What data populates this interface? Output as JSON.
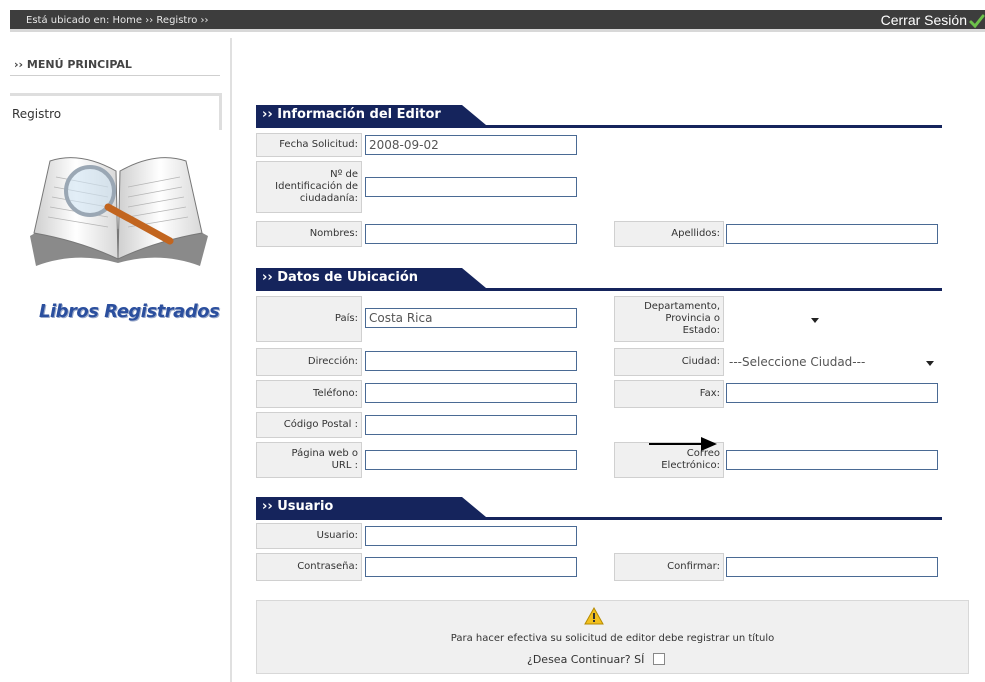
{
  "topbar": {
    "breadcrumb": "Está ubicado en: Home ›› Registro ››",
    "logout_label": "Cerrar Sesión"
  },
  "sidebar": {
    "menu_title": "›› MENÚ PRINCIPAL",
    "items": [
      {
        "label": "Registro"
      }
    ],
    "brand_text": "Libros Registrados"
  },
  "sections": {
    "editor": "›› Información del Editor",
    "ubicacion": "›› Datos de Ubicación",
    "usuario": "›› Usuario"
  },
  "editor": {
    "fecha_label": "Fecha Solicitud:",
    "fecha_value": "2008-09-02",
    "id_label_1": "Nº de",
    "id_label_2": "Identificación de",
    "id_label_3": "ciudadanía:",
    "id_value": "",
    "nombres_label": "Nombres:",
    "nombres_value": "",
    "apellidos_label": "Apellidos:",
    "apellidos_value": ""
  },
  "ubicacion": {
    "pais_label": "País:",
    "pais_value": "Costa Rica",
    "depto_label_1": "Departamento,",
    "depto_label_2": "Provincia o",
    "depto_label_3": "Estado:",
    "depto_value": "",
    "direccion_label": "Dirección:",
    "direccion_value": "",
    "ciudad_label": "Ciudad:",
    "ciudad_value": "---Seleccione Ciudad---",
    "telefono_label": "Teléfono:",
    "telefono_value": "",
    "fax_label": "Fax:",
    "fax_value": "",
    "postal_label": "Código Postal :",
    "postal_value": "",
    "web_label_1": "Página web o",
    "web_label_2": "URL :",
    "web_value": "",
    "correo_label_1": "Correo",
    "correo_label_2": "Electrónico:",
    "correo_value": ""
  },
  "usuario": {
    "usuario_label": "Usuario:",
    "usuario_value": "",
    "pass_label": "Contraseña:",
    "pass_value": "",
    "confirm_label": "Confirmar:",
    "confirm_value": ""
  },
  "notice": {
    "message": "Para hacer efectiva su solicitud de editor debe registrar un título",
    "question": "¿Desea Continuar? SÍ",
    "checked": false
  },
  "colors": {
    "section_bar": "#15245c",
    "topbar": "#3d3d3d",
    "input_border": "#4a6a94",
    "brand": "#2b4f9e",
    "check_icon": "#6cc24a",
    "warning_icon": "#f2c01e"
  },
  "icons": [
    "check-icon",
    "warning-icon",
    "magnifier-book-illustration",
    "arrow-annotation"
  ]
}
